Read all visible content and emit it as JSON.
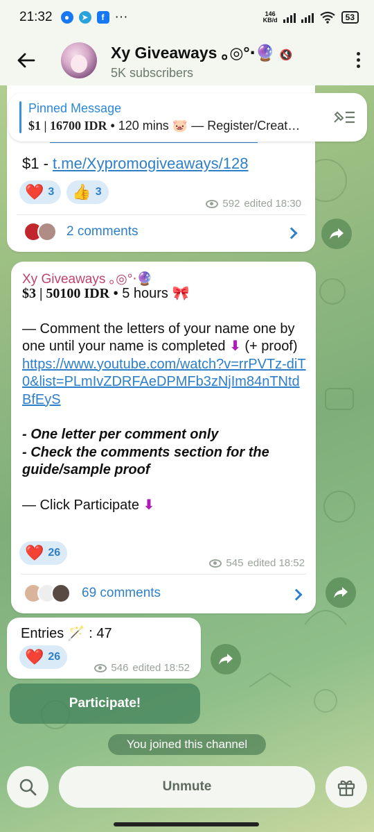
{
  "status_bar": {
    "time": "21:32",
    "net_speed_value": "146",
    "net_speed_unit": "KB/d",
    "battery": "53",
    "more_dots": "···"
  },
  "header": {
    "title": "Xy Giveaways ｡◎°‧🔮",
    "subtitle": "5K subscribers"
  },
  "pinned": {
    "title": "Pinned Message",
    "price": "$1 | 16700 IDR",
    "rest": " • 120 mins 🐷 — Register/Creat…"
  },
  "message1": {
    "prefix": "$1 - ",
    "link": "t.me/Xypromogiveaways/128",
    "reactions": [
      {
        "emoji": "❤️",
        "count": "3"
      },
      {
        "emoji": "👍",
        "count": "3"
      }
    ],
    "views": "592",
    "edited": "edited 18:30",
    "comments": "2 comments"
  },
  "message2": {
    "sender": "Xy Giveaways ｡◎°‧🔮",
    "price": "$3 | 50100 IDR",
    "duration": " • 5 hours 🎀",
    "line1": " — Comment the letters of your name one by one until your name is completed ",
    "line1_tail": " (+ proof)",
    "url": "https://www.youtube.com/watch?v=rrPVTz-diT0&list=PLmIvZDRFAeDPMFb3zNjIm84nTNtdBfEyS",
    "rule1": "- One letter per comment only",
    "rule2": "- Check the comments section for the guide/sample proof",
    "cta": "— Click Participate ",
    "arrow": "⬇",
    "reaction_emoji": "❤️",
    "reaction_count": "26",
    "views": "545",
    "edited": "edited 18:52",
    "comments": "69 comments"
  },
  "message3": {
    "text": "Entries 🪄 : 47",
    "reaction_emoji": "❤️",
    "reaction_count": "26",
    "views": "546",
    "edited": "edited 18:52"
  },
  "participate_button": "Participate!",
  "joined_notice": "You joined this channel",
  "bottom": {
    "unmute": "Unmute"
  },
  "colors": {
    "link": "#2e7fc9",
    "sender": "#c0426e",
    "reaction_bg": "#dbeaf7",
    "accent_arrow": "#b01ab8"
  }
}
